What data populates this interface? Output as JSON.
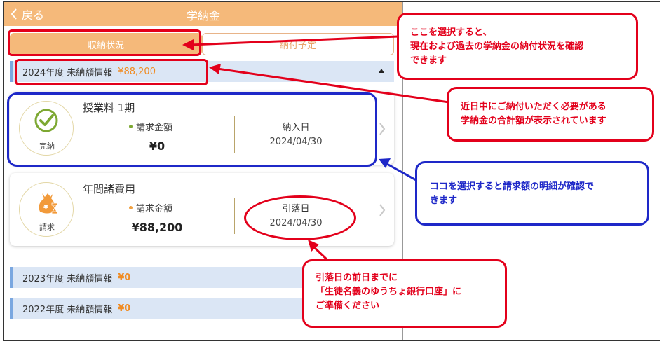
{
  "header": {
    "back_label": "戻る",
    "title": "学納金"
  },
  "tabs": [
    {
      "label": "収納状況",
      "active": true
    },
    {
      "label": "納付予定",
      "active": false
    }
  ],
  "year_sections": [
    {
      "label": "2024年度 未納額情報",
      "amount": "¥88,200"
    },
    {
      "label": "2023年度 未納額情報",
      "amount": "¥0"
    },
    {
      "label": "2022年度 未納額情報",
      "amount": "¥0"
    }
  ],
  "cards": [
    {
      "title": "授業料 1期",
      "status": "完納",
      "bill_label": "請求金額",
      "amount": "¥0",
      "date_label": "納入日",
      "date": "2024/04/30"
    },
    {
      "title": "年間諸費用",
      "status": "請求",
      "bill_label": "請求金額",
      "amount": "¥88,200",
      "date_label": "引落日",
      "date": "2024/04/30"
    }
  ],
  "annotations": {
    "tab_note": [
      "ここを選択すると、",
      "現在および過去の学納金の納付状況を確認",
      "できます"
    ],
    "total_note": [
      "近日中にご納付いただく必要がある",
      "学納金の合計額が表示されています"
    ],
    "detail_note": [
      "ココを選択すると請求額の明細が確認で",
      "きます"
    ],
    "debit_note": [
      "引落日の前日までに",
      "「生徒名義のゆうちょ銀行口座」に",
      "ご準備ください"
    ]
  },
  "colors": {
    "accent": "#f5b97a",
    "amount": "#f08c24",
    "annotation_red": "#e3001b",
    "annotation_blue": "#1e28c8"
  }
}
